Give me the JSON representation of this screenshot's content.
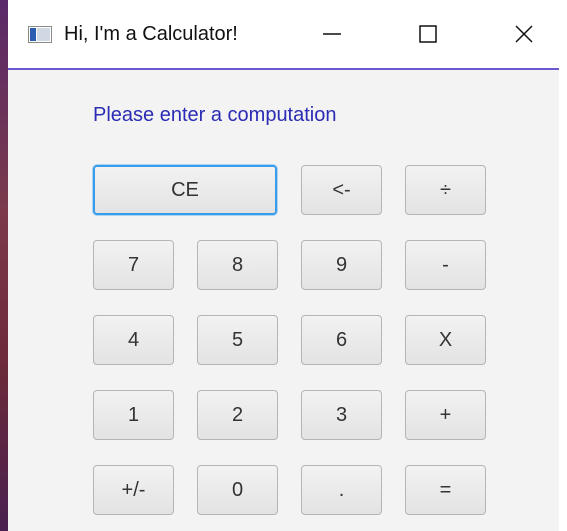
{
  "window": {
    "title": "Hi, I'm a Calculator!"
  },
  "titlebar": {
    "icon": "app-window-icon",
    "minimize_icon": "minimize-icon",
    "maximize_icon": "maximize-icon",
    "close_icon": "close-icon"
  },
  "main": {
    "prompt": "Please enter a computation"
  },
  "keypad": {
    "ce": "CE",
    "backspace": "<-",
    "divide": "÷",
    "seven": "7",
    "eight": "8",
    "nine": "9",
    "minus": "-",
    "four": "4",
    "five": "5",
    "six": "6",
    "multiply": "X",
    "one": "1",
    "two": "2",
    "three": "3",
    "plus": "+",
    "negate": "+/-",
    "zero": "0",
    "decimal": ".",
    "equals": "="
  },
  "colors": {
    "prompt_text": "#2b2bb5",
    "focus_ring": "#3c9be6",
    "window_border_accent": "#6a5ad0"
  }
}
